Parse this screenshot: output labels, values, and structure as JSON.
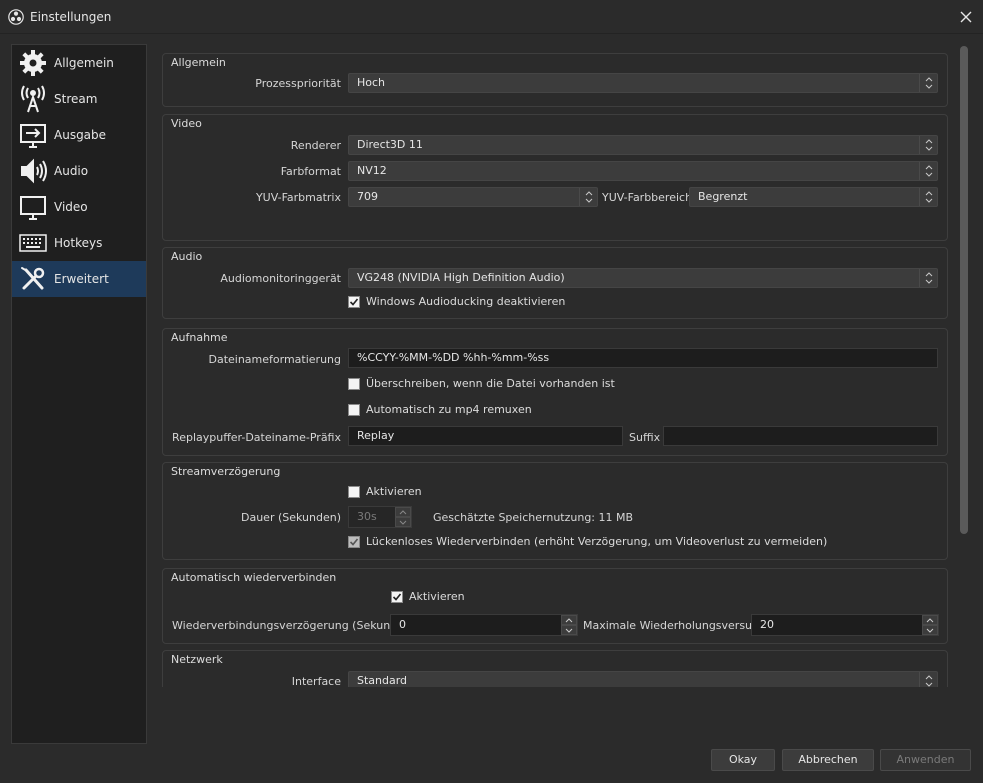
{
  "window": {
    "title": "Einstellungen"
  },
  "sidebar": {
    "items": [
      {
        "label": "Allgemein",
        "icon": "gear-icon"
      },
      {
        "label": "Stream",
        "icon": "antenna-icon"
      },
      {
        "label": "Ausgabe",
        "icon": "output-icon"
      },
      {
        "label": "Audio",
        "icon": "speaker-icon"
      },
      {
        "label": "Video",
        "icon": "monitor-icon"
      },
      {
        "label": "Hotkeys",
        "icon": "keyboard-icon"
      },
      {
        "label": "Erweitert",
        "icon": "tools-icon",
        "active": true
      }
    ]
  },
  "general": {
    "title": "Allgemein",
    "priority_label": "Prozesspriorität",
    "priority_value": "Hoch"
  },
  "video": {
    "title": "Video",
    "renderer_label": "Renderer",
    "renderer_value": "Direct3D 11",
    "format_label": "Farbformat",
    "format_value": "NV12",
    "matrix_label": "YUV-Farbmatrix",
    "matrix_value": "709",
    "range_label": "YUV-Farbbereich",
    "range_value": "Begrenzt"
  },
  "audio": {
    "title": "Audio",
    "monitor_label": "Audiomonitoringgerät",
    "monitor_value": "VG248 (NVIDIA High Definition Audio)",
    "ducking_label": "Windows Audioducking deaktivieren",
    "ducking_checked": true
  },
  "recording": {
    "title": "Aufnahme",
    "filename_label": "Dateinameformatierung",
    "filename_value": "%CCYY-%MM-%DD %hh-%mm-%ss",
    "overwrite_label": "Überschreiben, wenn die Datei vorhanden ist",
    "overwrite_checked": false,
    "remux_label": "Automatisch zu mp4 remuxen",
    "remux_checked": false,
    "replay_prefix_label": "Replaypuffer-Dateiname-Präfix",
    "replay_prefix_value": "Replay",
    "suffix_label": "Suffix",
    "suffix_value": ""
  },
  "stream_delay": {
    "title": "Streamverzögerung",
    "enable_label": "Aktivieren",
    "enable_checked": false,
    "duration_label": "Dauer (Sekunden)",
    "duration_value": "30s",
    "memory_text": "Geschätzte Speichernutzung: 11 MB",
    "preserve_label": "Lückenloses Wiederverbinden (erhöht Verzögerung, um Videoverlust zu vermeiden)",
    "preserve_checked": true
  },
  "reconnect": {
    "title": "Automatisch wiederverbinden",
    "enable_label": "Aktivieren",
    "enable_checked": true,
    "delay_label": "Wiederverbindungsverzögerung (Sekunden)",
    "delay_value": "0",
    "retries_label": "Maximale Wiederholungsversuche",
    "retries_value": "20"
  },
  "network": {
    "title": "Netzwerk",
    "interface_label": "Interface",
    "interface_value": "Standard"
  },
  "buttons": {
    "ok": "Okay",
    "cancel": "Abbrechen",
    "apply": "Anwenden"
  }
}
